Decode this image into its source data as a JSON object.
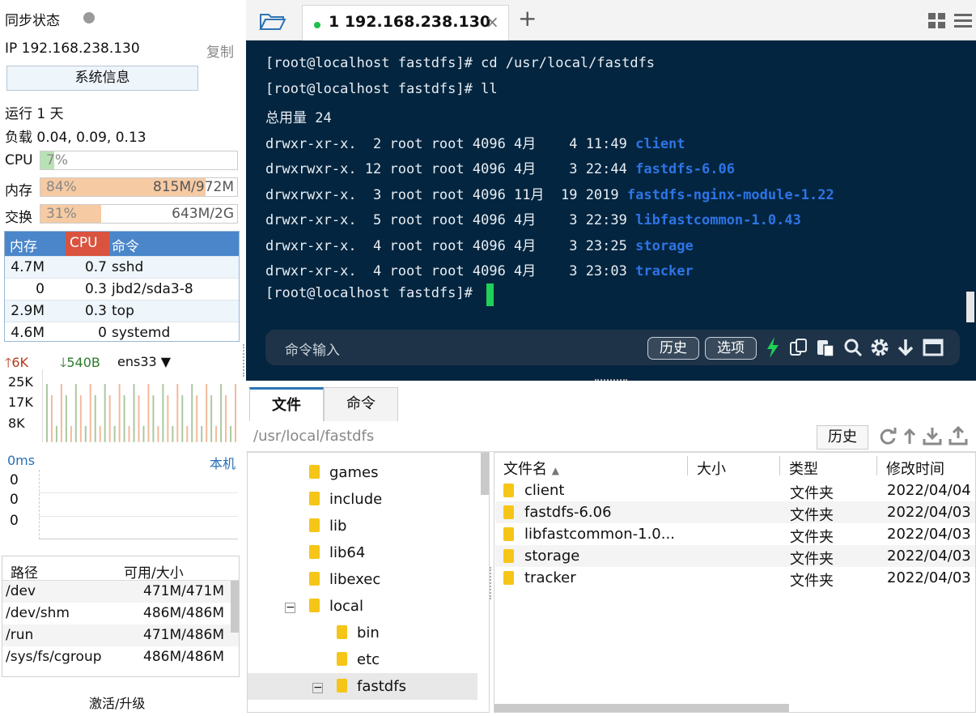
{
  "left": {
    "sync_label": "同步状态",
    "ip_label": "IP 192.168.238.130",
    "copy_label": "复制",
    "sysinfo_button": "系统信息",
    "uptime": "运行 1 天",
    "load": "负载 0.04, 0.09, 0.13",
    "cpu": {
      "label": "CPU",
      "percent": "7%",
      "value": 7
    },
    "mem": {
      "label": "内存",
      "percent": "84%",
      "size": "815M/972M",
      "value": 84
    },
    "swap": {
      "label": "交换",
      "percent": "31%",
      "size": "643M/2G",
      "value": 31
    },
    "proc_headers": [
      "内存",
      "CPU",
      "命令"
    ],
    "processes": [
      {
        "mem": "4.7M",
        "cpu": "0.7",
        "cmd": "sshd"
      },
      {
        "mem": "0",
        "cpu": "0.3",
        "cmd": "jbd2/sda3-8"
      },
      {
        "mem": "2.9M",
        "cpu": "0.3",
        "cmd": "top"
      },
      {
        "mem": "4.6M",
        "cpu": "0",
        "cmd": "systemd"
      }
    ],
    "net": {
      "up": "6K",
      "down": "540B",
      "iface": "ens33",
      "ticks": [
        "25K",
        "17K",
        "8K"
      ]
    },
    "ping": {
      "ms": "0ms",
      "host": "本机",
      "vals": [
        "0",
        "0",
        "0"
      ]
    },
    "disk_headers": [
      "路径",
      "可用/大小"
    ],
    "disks": [
      {
        "path": "/dev",
        "size": "471M/471M"
      },
      {
        "path": "/dev/shm",
        "size": "486M/486M"
      },
      {
        "path": "/run",
        "size": "471M/486M"
      },
      {
        "path": "/sys/fs/cgroup",
        "size": "486M/486M"
      }
    ],
    "activate": "激活/升级",
    "status_color": "#9a9a9a"
  },
  "terminal": {
    "tab_title": "1 192.168.238.130",
    "lines": [
      {
        "text": "[root@localhost fastdfs]# cd /usr/local/fastdfs",
        "dir": ""
      },
      {
        "text": "[root@localhost fastdfs]# ll",
        "dir": ""
      },
      {
        "text": "总用量 24",
        "dir": ""
      },
      {
        "text": "drwxr-xr-x.  2 root root 4096 4月    4 11:49 ",
        "dir": "client"
      },
      {
        "text": "drwxrwxr-x. 12 root root 4096 4月    3 22:44 ",
        "dir": "fastdfs-6.06"
      },
      {
        "text": "drwxrwxr-x.  3 root root 4096 11月  19 2019 ",
        "dir": "fastdfs-nginx-module-1.22"
      },
      {
        "text": "drwxr-xr-x.  5 root root 4096 4月    3 22:39 ",
        "dir": "libfastcommon-1.0.43"
      },
      {
        "text": "drwxr-xr-x.  4 root root 4096 4月    3 23:25 ",
        "dir": "storage"
      },
      {
        "text": "drwxr-xr-x.  4 root root 4096 4月    3 23:03 ",
        "dir": "tracker"
      },
      {
        "text": "[root@localhost fastdfs]# ",
        "dir": ""
      }
    ],
    "cmd_placeholder": "命令输入",
    "history_btn": "历史",
    "options_btn": "选项"
  },
  "files": {
    "tabs": [
      "文件",
      "命令"
    ],
    "path": "/usr/local/fastdfs",
    "history_btn": "历史",
    "tree": [
      {
        "name": "games",
        "depth": 0,
        "toggle": ""
      },
      {
        "name": "include",
        "depth": 0,
        "toggle": ""
      },
      {
        "name": "lib",
        "depth": 0,
        "toggle": ""
      },
      {
        "name": "lib64",
        "depth": 0,
        "toggle": ""
      },
      {
        "name": "libexec",
        "depth": 0,
        "toggle": ""
      },
      {
        "name": "local",
        "depth": 0,
        "toggle": "−"
      },
      {
        "name": "bin",
        "depth": 1,
        "toggle": ""
      },
      {
        "name": "etc",
        "depth": 1,
        "toggle": ""
      },
      {
        "name": "fastdfs",
        "depth": 1,
        "toggle": "−"
      }
    ],
    "columns": [
      "文件名",
      "大小",
      "类型",
      "修改时间"
    ],
    "rows": [
      {
        "name": "client",
        "size": "",
        "type": "文件夹",
        "date": "2022/04/04"
      },
      {
        "name": "fastdfs-6.06",
        "size": "",
        "type": "文件夹",
        "date": "2022/04/03"
      },
      {
        "name": "libfastcommon-1.0...",
        "size": "",
        "type": "文件夹",
        "date": "2022/04/03"
      },
      {
        "name": "storage",
        "size": "",
        "type": "文件夹",
        "date": "2022/04/03"
      },
      {
        "name": "tracker",
        "size": "",
        "type": "文件夹",
        "date": "2022/04/03"
      }
    ]
  }
}
